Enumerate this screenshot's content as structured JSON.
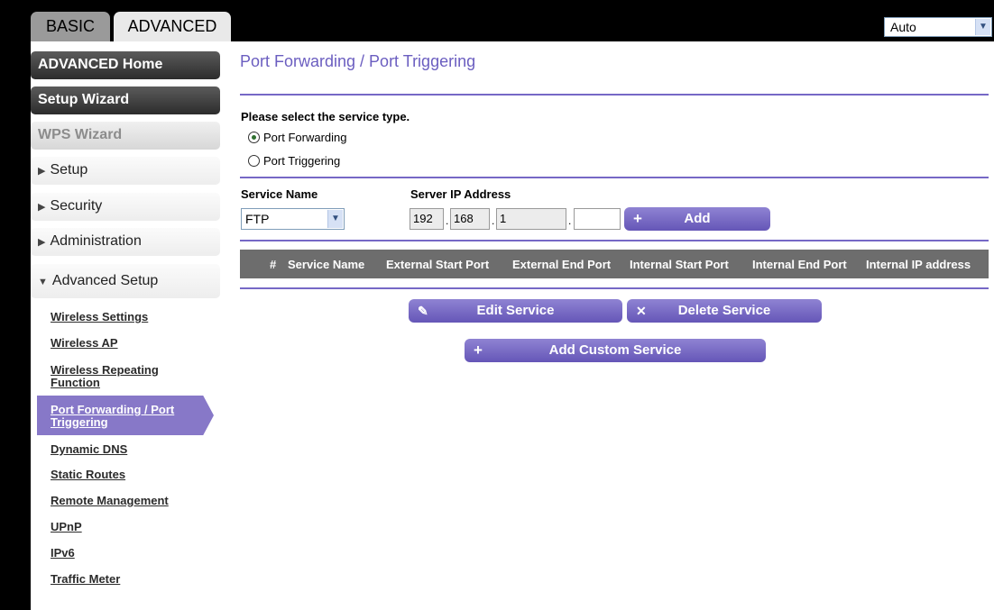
{
  "tabs": {
    "basic": "BASIC",
    "advanced": "ADVANCED"
  },
  "language": {
    "value": "Auto"
  },
  "sidebar": {
    "buttons": [
      {
        "label": "ADVANCED Home"
      },
      {
        "label": "Setup Wizard"
      },
      {
        "label": "WPS Wizard"
      },
      {
        "label": "Setup",
        "icon": "triangle-right"
      },
      {
        "label": "Security",
        "icon": "triangle-right"
      },
      {
        "label": "Administration",
        "icon": "triangle-right"
      },
      {
        "label": "Advanced Setup",
        "icon": "triangle-down"
      }
    ],
    "sublinks": [
      "Wireless Settings",
      "Wireless AP",
      "Wireless Repeating Function",
      "Port Forwarding / Port Triggering",
      "Dynamic DNS",
      "Static Routes",
      "Remote Management",
      "UPnP",
      "IPv6",
      "Traffic Meter"
    ]
  },
  "main": {
    "title": "Port Forwarding / Port Triggering",
    "service_type_prompt": "Please select the service type.",
    "radio_forwarding": "Port Forwarding",
    "radio_triggering": "Port Triggering",
    "service_name_label": "Service Name",
    "server_ip_label": "Server IP Address",
    "service_value": "FTP",
    "ip": [
      "192",
      "168",
      "1",
      ""
    ],
    "add_label": "Add",
    "columns": [
      "#",
      "Service Name",
      "External Start Port",
      "External End Port",
      "Internal Start Port",
      "Internal End Port",
      "Internal IP address"
    ],
    "edit_label": "Edit Service",
    "delete_label": "Delete Service",
    "add_custom_label": "Add Custom Service"
  },
  "colors": {
    "accent": "#7668c6",
    "button": "#6d5fc0",
    "header": "#6d6d6d"
  }
}
